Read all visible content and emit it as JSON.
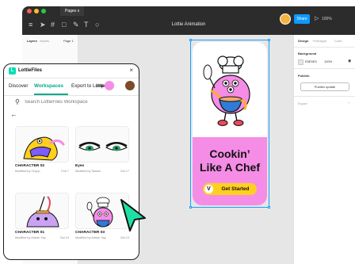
{
  "figma": {
    "tab_title": "Pages",
    "tab_close": "x",
    "file_title": "Lottie Animation",
    "share_label": "Share",
    "zoom_label": "100%",
    "left_tabs": [
      "Layers",
      "Assets",
      "Page 1"
    ],
    "right_tabs": [
      "Design",
      "Prototype",
      "Code"
    ],
    "background_label": "Background",
    "background_hex": "E5E5E5",
    "background_opacity": "100%",
    "publish_label": "Publish",
    "publish_button": "Publish update",
    "export_label": "Export"
  },
  "artboard": {
    "title_line1": "Cookin’",
    "title_line2": "Like A Chef",
    "button_label": "Get Started",
    "button_icon": "V",
    "pink": "#f58ce6",
    "yellow": "#ffcf1f"
  },
  "plugin": {
    "title": "LottieFiles",
    "logo_letter": "L",
    "close": "×",
    "tabs": [
      "Discover",
      "Workspaces",
      "Export to Lottie",
      "Imp"
    ],
    "active_tab": "Workspaces",
    "search_placeholder": "Search LottieFiles Workspace",
    "back": "←",
    "accent": "#00a98a",
    "cards": [
      {
        "name": "CHARACTER 02",
        "meta": "Modified by Chyup",
        "date": "Feb 7"
      },
      {
        "name": "Eyes",
        "meta": "Modified by Saisee",
        "date": "Oct 17"
      },
      {
        "name": "CHARACTER 01",
        "meta": "Modified by Adrian Yap",
        "date": "Oct 10"
      },
      {
        "name": "CHARACTER 03",
        "meta": "Modified by Adrian Yap",
        "date": "Oct 10"
      }
    ]
  },
  "icons": [
    "move-icon",
    "frame-icon",
    "shape-icon",
    "pen-icon",
    "text-icon",
    "comment-icon",
    "play-icon",
    "search-icon",
    "cursor-icon"
  ]
}
